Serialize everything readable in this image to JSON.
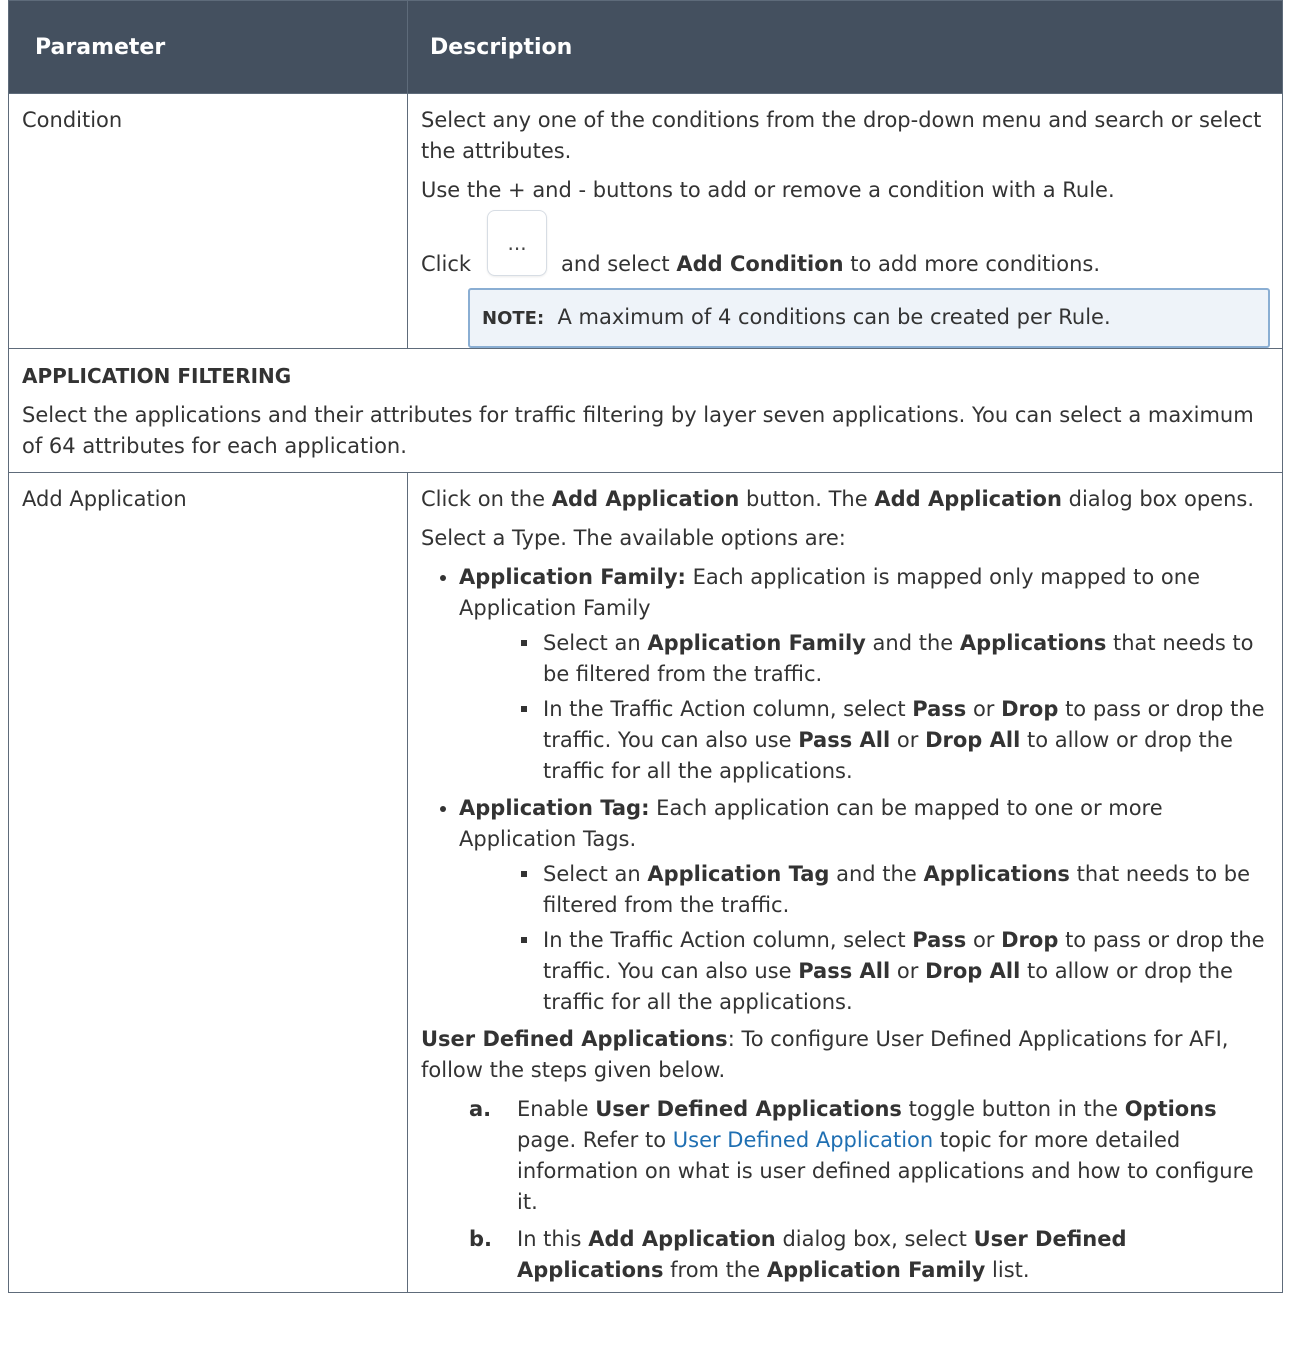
{
  "header": {
    "parameter": "Parameter",
    "description": "Description"
  },
  "condition": {
    "name": "Condition",
    "p1": "Select any one of the conditions from the drop-down menu and search or select the attributes.",
    "p2": "Use the + and - buttons to add or remove a condition with a Rule.",
    "click": "Click",
    "more_button": "...",
    "and_select": "and select",
    "add_condition": "Add Condition",
    "to_add": "to add more conditions.",
    "note_label": "NOTE:",
    "note_text": "A maximum of 4 conditions can be created per Rule."
  },
  "app_filtering": {
    "title": "APPLICATION FILTERING",
    "text": "Select the applications and their attributes for traffic filtering by layer seven applications. You can select a maximum of 64 attributes for each application."
  },
  "add_application": {
    "name": "Add Application",
    "click_on": "Click on the",
    "add_app": "Add Application",
    "button_the": "button. The",
    "dialog_opens": "dialog box opens.",
    "select_type": "Select a Type. The available options are:",
    "family": {
      "label": "Application Family:",
      "text": "Each application is mapped only mapped to one Application Family",
      "s1_a": "Select an",
      "s1_b": "Application Family",
      "s1_c": "and the",
      "s1_d": "Applications",
      "s1_e": "that needs to be filtered from the traffic."
    },
    "tag": {
      "label": "Application Tag:",
      "text": "Each application can be mapped to one or more Application Tags.",
      "s1_a": "Select an",
      "s1_b": "Application Tag",
      "s1_c": "and the",
      "s1_d": "Applications",
      "s1_e": "that needs to be filtered from the traffic."
    },
    "action": {
      "a": "In the Traffic Action column, select",
      "pass": "Pass",
      "or": "or",
      "drop": "Drop",
      "b": "to pass or drop the traffic. You can also use",
      "pass_all": "Pass All",
      "drop_all": "Drop All",
      "c": "to allow or drop the traffic for all the applications."
    },
    "uda": {
      "label": "User Defined Applications",
      "text": ": To configure User Defined Applications for AFI, follow the steps given below.",
      "a_mark": "a.",
      "a1": "Enable",
      "a2": "User Defined Applications",
      "a3": "toggle button in the",
      "a4": "Options",
      "a5": "page. Refer to",
      "link": "User Defined Application",
      "a6": "topic for more detailed information on what is user defined applications and how to configure it.",
      "b_mark": "b.",
      "b1": "In this",
      "b2": "Add Application",
      "b3": "dialog box, select",
      "b4": "User Defined Applications",
      "b5": "from the",
      "b6": "Application Family",
      "b7": "list."
    }
  }
}
